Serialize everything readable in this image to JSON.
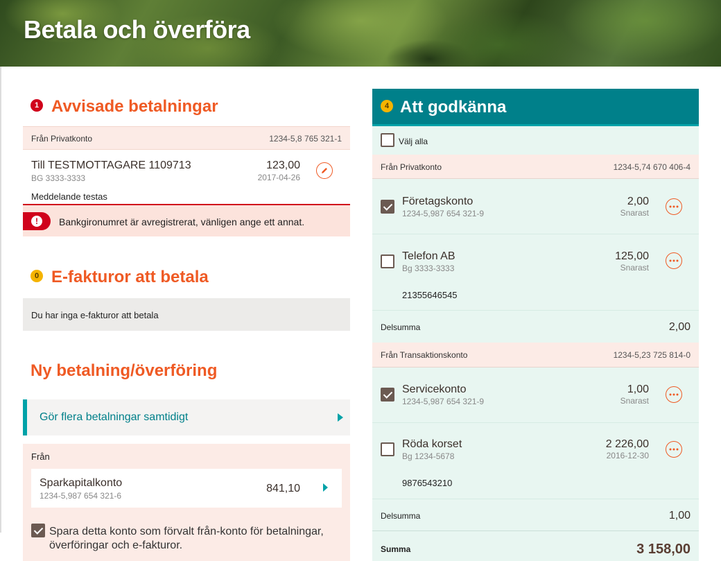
{
  "page": {
    "title": "Betala och överföra"
  },
  "rejected": {
    "badge": "1",
    "title": "Avvisade betalningar",
    "from_label": "Från Privatkonto",
    "from_account": "1234-5,8 765 321-1",
    "payment": {
      "name": "Till TESTMOTTAGARE 1109713",
      "sub": "BG 3333-3333",
      "amount": "123,00",
      "date": "2017-04-26",
      "message": "Meddelande testas"
    },
    "error_text": "Bankgironumret är avregistrerat, vänligen ange ett annat."
  },
  "efakturor": {
    "badge": "0",
    "title": "E-fakturor att betala",
    "empty_text": "Du har inga e-fakturor att betala"
  },
  "new_payment": {
    "title": "Ny betalning/överföring",
    "multi_link": "Gör flera betalningar samtidigt",
    "from_label": "Från",
    "account_name": "Sparkapitalkonto",
    "account_number": "1234-5,987 654 321-6",
    "account_balance": "841,10",
    "save_default_line1": "Spara detta konto som förvalt från-konto för betalningar,",
    "save_default_line2": "överföringar och e-fakturor."
  },
  "approve": {
    "badge": "4",
    "title": "Att godkänna",
    "select_all": "Välj alla",
    "groups": [
      {
        "from_label": "Från Privatkonto",
        "from_account": "1234-5,74 670 406-4",
        "items": [
          {
            "name": "Företagskonto",
            "sub": "1234-5,987 654 321-9",
            "amount": "2,00",
            "when": "Snarast",
            "checked": true,
            "message": ""
          },
          {
            "name": "Telefon AB",
            "sub": "Bg 3333-3333",
            "amount": "125,00",
            "when": "Snarast",
            "checked": false,
            "message": "21355646545"
          }
        ],
        "subtotal_label": "Delsumma",
        "subtotal": "2,00"
      },
      {
        "from_label": "Från Transaktionskonto",
        "from_account": "1234-5,23 725 814-0",
        "items": [
          {
            "name": "Servicekonto",
            "sub": "1234-5,987 654 321-9",
            "amount": "1,00",
            "when": "Snarast",
            "checked": true,
            "message": ""
          },
          {
            "name": "Röda korset",
            "sub": "Bg 1234-5678",
            "amount": "2 226,00",
            "when": "2016-12-30",
            "checked": false,
            "message": "9876543210"
          }
        ],
        "subtotal_label": "Delsumma",
        "subtotal": "1,00"
      }
    ],
    "total_label": "Summa",
    "total": "3 158,00"
  },
  "colors": {
    "accent_orange": "#ef5a24",
    "teal": "#00808a",
    "error_red": "#d0021b",
    "badge_yellow": "#f5b400"
  }
}
